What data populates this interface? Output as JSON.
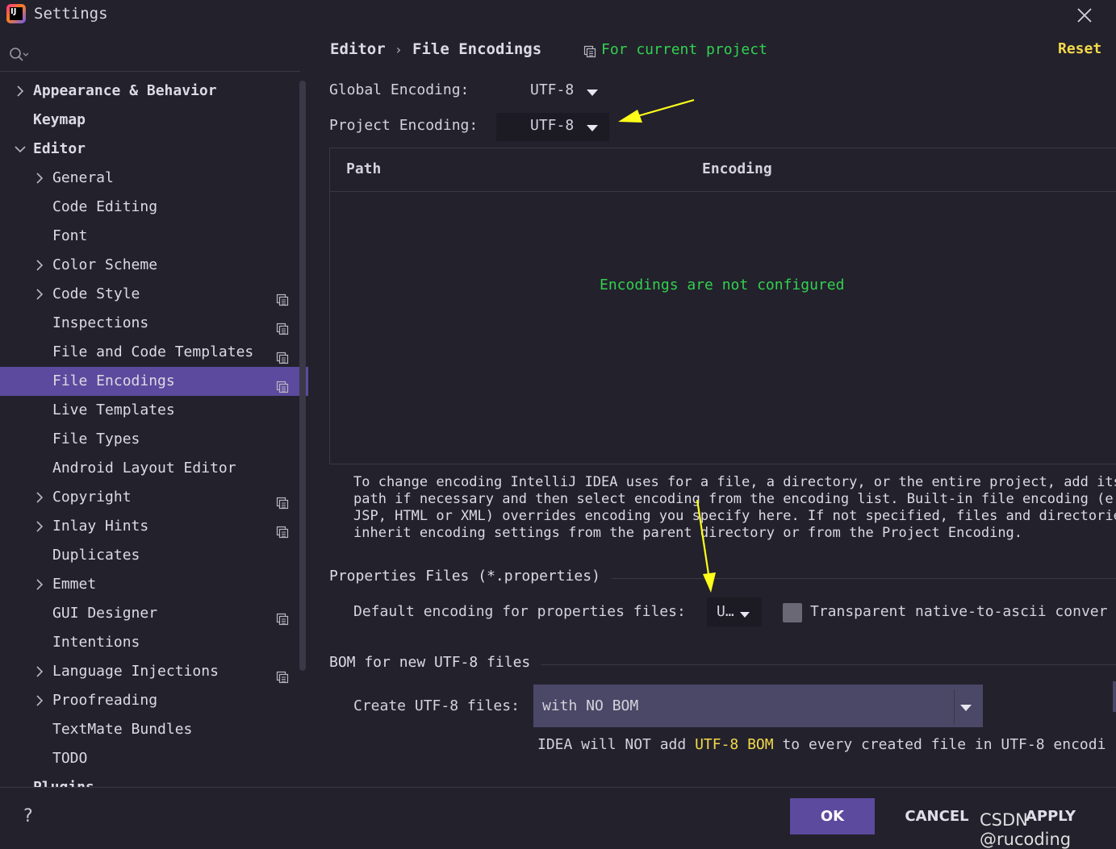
{
  "window": {
    "title": "Settings",
    "logo_text": "IJ"
  },
  "search": {
    "placeholder": ""
  },
  "sidebar": {
    "items": [
      {
        "label": "Appearance & Behavior",
        "expander": "collapsed",
        "level": 0,
        "bold": true,
        "project_icon": false,
        "selected": false
      },
      {
        "label": "Keymap",
        "expander": "none",
        "level": 0,
        "bold": true,
        "project_icon": false,
        "selected": false
      },
      {
        "label": "Editor",
        "expander": "expanded",
        "level": 0,
        "bold": true,
        "project_icon": false,
        "selected": false
      },
      {
        "label": "General",
        "expander": "collapsed",
        "level": 1,
        "bold": false,
        "project_icon": false,
        "selected": false
      },
      {
        "label": "Code Editing",
        "expander": "none",
        "level": 1,
        "bold": false,
        "project_icon": false,
        "selected": false
      },
      {
        "label": "Font",
        "expander": "none",
        "level": 1,
        "bold": false,
        "project_icon": false,
        "selected": false
      },
      {
        "label": "Color Scheme",
        "expander": "collapsed",
        "level": 1,
        "bold": false,
        "project_icon": false,
        "selected": false
      },
      {
        "label": "Code Style",
        "expander": "collapsed",
        "level": 1,
        "bold": false,
        "project_icon": true,
        "selected": false
      },
      {
        "label": "Inspections",
        "expander": "none",
        "level": 1,
        "bold": false,
        "project_icon": true,
        "selected": false
      },
      {
        "label": "File and Code Templates",
        "expander": "none",
        "level": 1,
        "bold": false,
        "project_icon": true,
        "selected": false
      },
      {
        "label": "File Encodings",
        "expander": "none",
        "level": 1,
        "bold": false,
        "project_icon": true,
        "selected": true
      },
      {
        "label": "Live Templates",
        "expander": "none",
        "level": 1,
        "bold": false,
        "project_icon": false,
        "selected": false
      },
      {
        "label": "File Types",
        "expander": "none",
        "level": 1,
        "bold": false,
        "project_icon": false,
        "selected": false
      },
      {
        "label": "Android Layout Editor",
        "expander": "none",
        "level": 1,
        "bold": false,
        "project_icon": false,
        "selected": false
      },
      {
        "label": "Copyright",
        "expander": "collapsed",
        "level": 1,
        "bold": false,
        "project_icon": true,
        "selected": false
      },
      {
        "label": "Inlay Hints",
        "expander": "collapsed",
        "level": 1,
        "bold": false,
        "project_icon": true,
        "selected": false
      },
      {
        "label": "Duplicates",
        "expander": "none",
        "level": 1,
        "bold": false,
        "project_icon": false,
        "selected": false
      },
      {
        "label": "Emmet",
        "expander": "collapsed",
        "level": 1,
        "bold": false,
        "project_icon": false,
        "selected": false
      },
      {
        "label": "GUI Designer",
        "expander": "none",
        "level": 1,
        "bold": false,
        "project_icon": true,
        "selected": false
      },
      {
        "label": "Intentions",
        "expander": "none",
        "level": 1,
        "bold": false,
        "project_icon": false,
        "selected": false
      },
      {
        "label": "Language Injections",
        "expander": "collapsed",
        "level": 1,
        "bold": false,
        "project_icon": true,
        "selected": false
      },
      {
        "label": "Proofreading",
        "expander": "collapsed",
        "level": 1,
        "bold": false,
        "project_icon": false,
        "selected": false
      },
      {
        "label": "TextMate Bundles",
        "expander": "none",
        "level": 1,
        "bold": false,
        "project_icon": false,
        "selected": false
      },
      {
        "label": "TODO",
        "expander": "none",
        "level": 1,
        "bold": false,
        "project_icon": false,
        "selected": false
      },
      {
        "label": "Plugins",
        "expander": "none",
        "level": 0,
        "bold": true,
        "project_icon": false,
        "selected": false
      }
    ]
  },
  "header": {
    "breadcrumb_editor": "Editor",
    "breadcrumb_separator": "›",
    "breadcrumb_page": "File Encodings",
    "scope_label": "For current project",
    "reset_label": "Reset"
  },
  "encodings": {
    "global_label": "Global Encoding:",
    "global_value": "UTF-8",
    "project_label": "Project Encoding:",
    "project_value": "UTF-8"
  },
  "table": {
    "col_path": "Path",
    "col_encoding": "Encoding",
    "empty_text": "Encodings are not configured"
  },
  "help_text": "To change encoding IntelliJ IDEA uses for a file, a directory, or the entire project, add its\npath if necessary and then select encoding from the encoding list. Built-in file encoding (e.g\nJSP, HTML or XML) overrides encoding you specify here. If not specified, files and directories\ninherit encoding settings from the parent directory or from the Project Encoding.",
  "properties": {
    "section_title": "Properties Files (*.properties)",
    "default_label": "Default encoding for properties files:",
    "default_value": "U…",
    "native_label": "Transparent native-to-ascii conver",
    "native_checked": false
  },
  "bom": {
    "section_title": "BOM for new UTF-8 files",
    "create_label": "Create UTF-8 files:",
    "create_value": "with NO BOM",
    "note_prefix": "IDEA will NOT add ",
    "note_highlight": "UTF-8 BOM",
    "note_suffix": " to every created file in UTF-8 encodi"
  },
  "footer": {
    "help": "?",
    "ok": "OK",
    "cancel": "CANCEL",
    "apply": "APPLY"
  },
  "watermark": "CSDN @rucoding",
  "colors": {
    "background": "#23212c",
    "selection": "#5c4a9e",
    "green_text": "#32d14f",
    "yellow_accent": "#f4d94a",
    "annotation_arrow": "#ffff1a"
  }
}
